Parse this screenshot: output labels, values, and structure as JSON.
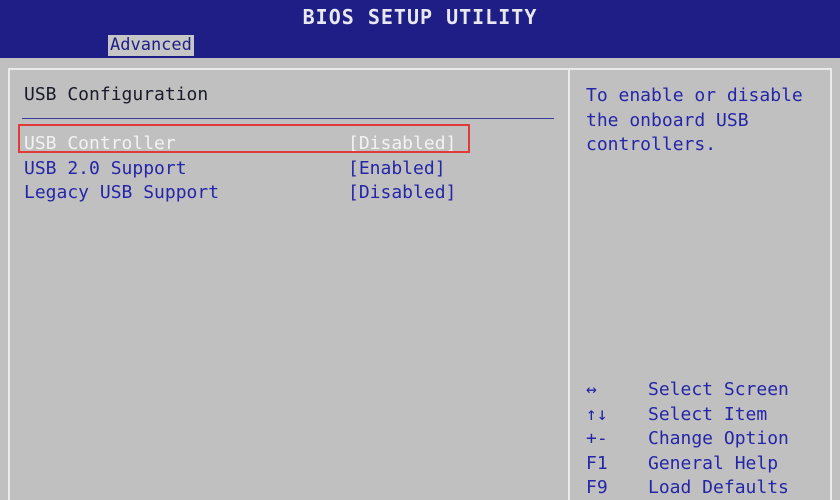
{
  "title": "BIOS SETUP UTILITY",
  "tab": {
    "label": "Advanced"
  },
  "section_title": "USB Configuration",
  "settings": [
    {
      "label": "USB Controller",
      "value": "[Disabled]"
    },
    {
      "label": "USB 2.0 Support",
      "value": "[Enabled]"
    },
    {
      "label": "Legacy USB Support",
      "value": "[Disabled]"
    }
  ],
  "help_text": "To enable or disable\nthe onboard USB\ncontrollers.",
  "legend": [
    {
      "key": "↔",
      "desc": "Select Screen",
      "icon": "left-right-arrow-icon"
    },
    {
      "key": "↑↓",
      "desc": "Select Item",
      "icon": "up-down-arrow-icon"
    },
    {
      "key": "+-",
      "desc": "Change Option",
      "icon": "plus-minus-icon"
    },
    {
      "key": "F1",
      "desc": "General Help",
      "icon": ""
    },
    {
      "key": "F9",
      "desc": "Load Defaults",
      "icon": ""
    }
  ],
  "colors": {
    "background": "#1a1a6a",
    "title_bar": "#1e1e86",
    "panel": "#c0c0c0",
    "text_blue": "#2525a8",
    "selected_text": "#f2f2f2",
    "highlight_border": "#e23a3a"
  }
}
